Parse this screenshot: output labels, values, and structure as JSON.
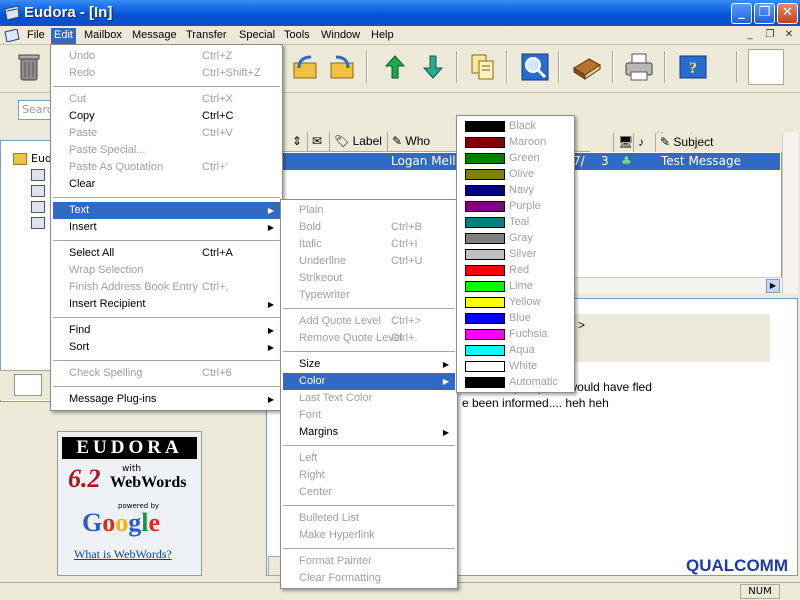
{
  "window": {
    "title": "Eudora - [In]"
  },
  "menubar": [
    {
      "label": "File"
    },
    {
      "label": "Edit"
    },
    {
      "label": "Mailbox"
    },
    {
      "label": "Message"
    },
    {
      "label": "Transfer"
    },
    {
      "label": "Special"
    },
    {
      "label": "Tools"
    },
    {
      "label": "Window"
    },
    {
      "label": "Help"
    }
  ],
  "toolbar": {
    "icons": [
      "trash-icon",
      "reply-all-icon",
      "forward-icon",
      "up-arrow-icon",
      "down-arrow-icon",
      "attach-icon",
      "find-icon",
      "address-book-icon",
      "print-icon",
      "help-icon"
    ]
  },
  "search": {
    "placeholder": "Search"
  },
  "mailboxes": {
    "root_label": "Eudo"
  },
  "message_list": {
    "columns": {
      "label": "Label",
      "who": "Who",
      "subject": "Subject"
    },
    "selected_row": {
      "who": "Logan Mell",
      "date": "7/",
      "size": "3",
      "subject": "Test Message"
    }
  },
  "preview": {
    "quote_mark": ">",
    "line1": "tual emergency, we would have fled",
    "line2": "e been informed.... heh heh"
  },
  "ad": {
    "brand": "EUDORA",
    "version": "6.2",
    "with": "with",
    "webwords": "WebWords",
    "powered_by": "powered by",
    "google": [
      "G",
      "o",
      "o",
      "g",
      "l",
      "e"
    ],
    "link": "What is WebWords?"
  },
  "qualcomm": "QUALCOMM",
  "status": {
    "num": "NUM"
  },
  "edit_menu": [
    {
      "label": "Undo",
      "shortcut": "Ctrl+Z",
      "disabled": true
    },
    {
      "label": "Redo",
      "shortcut": "Ctrl+Shift+Z",
      "disabled": true
    },
    {
      "label": "Cut",
      "shortcut": "Ctrl+X",
      "disabled": true
    },
    {
      "label": "Copy",
      "shortcut": "Ctrl+C",
      "disabled": false
    },
    {
      "label": "Paste",
      "shortcut": "Ctrl+V",
      "disabled": true
    },
    {
      "label": "Paste Special...",
      "shortcut": "",
      "disabled": true
    },
    {
      "label": "Paste As Quotation",
      "shortcut": "Ctrl+'",
      "disabled": true
    },
    {
      "label": "Clear",
      "shortcut": "",
      "disabled": false
    },
    {
      "label": "Text",
      "shortcut": "",
      "disabled": false
    },
    {
      "label": "Insert",
      "shortcut": "",
      "disabled": false
    },
    {
      "label": "Select All",
      "shortcut": "Ctrl+A",
      "disabled": false
    },
    {
      "label": "Wrap Selection",
      "shortcut": "",
      "disabled": true
    },
    {
      "label": "Finish Address Book Entry",
      "shortcut": "Ctrl+,",
      "disabled": true
    },
    {
      "label": "Insert Recipient",
      "shortcut": "",
      "disabled": false
    },
    {
      "label": "Find",
      "shortcut": "",
      "disabled": false
    },
    {
      "label": "Sort",
      "shortcut": "",
      "disabled": false
    },
    {
      "label": "Check Spelling",
      "shortcut": "Ctrl+6",
      "disabled": true
    },
    {
      "label": "Message Plug-ins",
      "shortcut": "",
      "disabled": false
    }
  ],
  "text_menu": [
    {
      "label": "Plain",
      "shortcut": ""
    },
    {
      "label": "Bold",
      "shortcut": "Ctrl+B"
    },
    {
      "label": "Italic",
      "shortcut": "Ctrl+I"
    },
    {
      "label": "Underline",
      "shortcut": "Ctrl+U"
    },
    {
      "label": "Strikeout",
      "shortcut": ""
    },
    {
      "label": "Typewriter",
      "shortcut": ""
    },
    {
      "label": "Add Quote Level",
      "shortcut": "Ctrl+>"
    },
    {
      "label": "Remove Quote Level",
      "shortcut": "Ctrl+."
    },
    {
      "label": "Size",
      "shortcut": ""
    },
    {
      "label": "Color",
      "shortcut": ""
    },
    {
      "label": "Last Text Color",
      "shortcut": ""
    },
    {
      "label": "Font",
      "shortcut": ""
    },
    {
      "label": "Margins",
      "shortcut": ""
    },
    {
      "label": "Left",
      "shortcut": ""
    },
    {
      "label": "Right",
      "shortcut": ""
    },
    {
      "label": "Center",
      "shortcut": ""
    },
    {
      "label": "Bulleted List",
      "shortcut": ""
    },
    {
      "label": "Make Hyperlink",
      "shortcut": ""
    },
    {
      "label": "Format Painter",
      "shortcut": ""
    },
    {
      "label": "Clear Formatting",
      "shortcut": ""
    }
  ],
  "color_menu": [
    {
      "label": "Black",
      "color": "#000000"
    },
    {
      "label": "Maroon",
      "color": "#800000"
    },
    {
      "label": "Green",
      "color": "#008000"
    },
    {
      "label": "Olive",
      "color": "#808000"
    },
    {
      "label": "Navy",
      "color": "#000080"
    },
    {
      "label": "Purple",
      "color": "#800080"
    },
    {
      "label": "Teal",
      "color": "#008080"
    },
    {
      "label": "Gray",
      "color": "#808080"
    },
    {
      "label": "Silver",
      "color": "#c0c0c0"
    },
    {
      "label": "Red",
      "color": "#ff0000"
    },
    {
      "label": "Lime",
      "color": "#00ff00"
    },
    {
      "label": "Yellow",
      "color": "#ffff00"
    },
    {
      "label": "Blue",
      "color": "#0000ff"
    },
    {
      "label": "Fuchsia",
      "color": "#ff00ff"
    },
    {
      "label": "Aqua",
      "color": "#00ffff"
    },
    {
      "label": "White",
      "color": "#ffffff"
    },
    {
      "label": "Automatic",
      "color": "#000000"
    }
  ]
}
